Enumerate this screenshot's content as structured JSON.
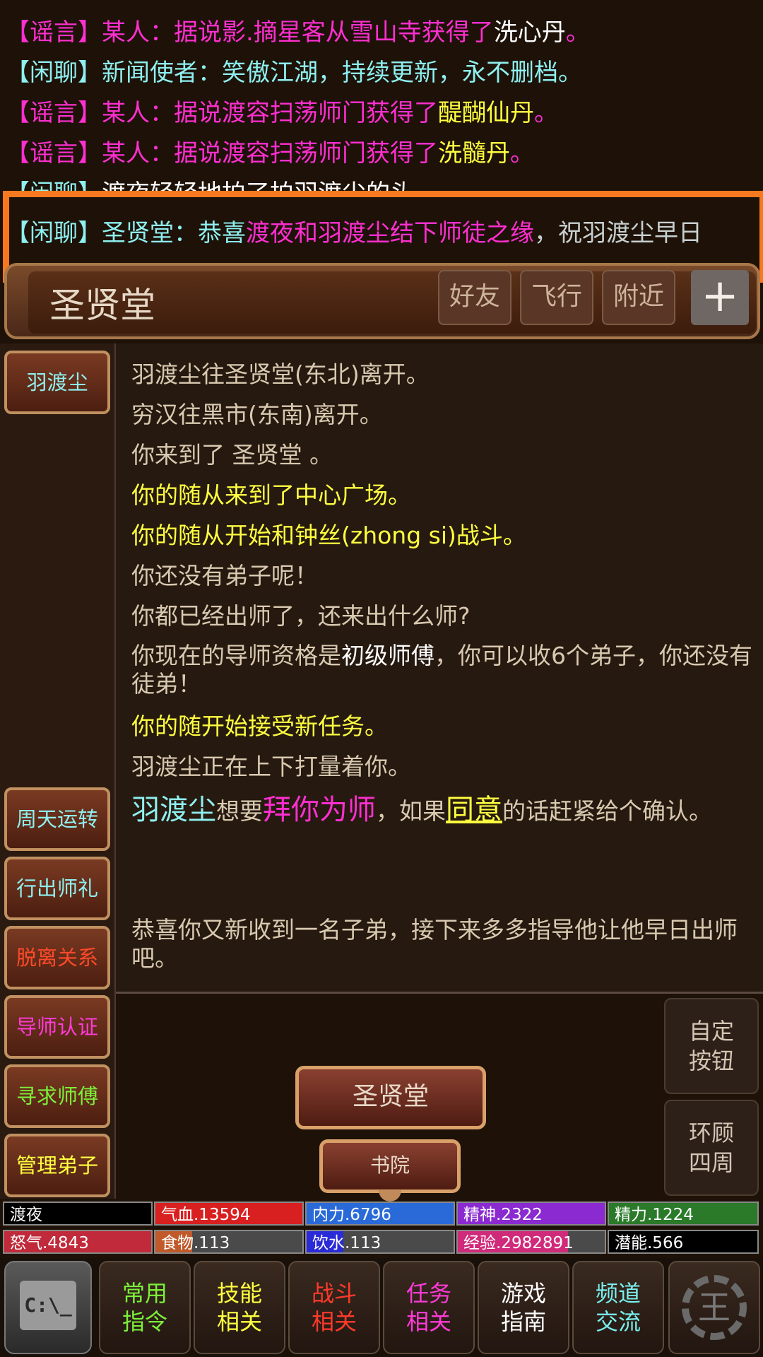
{
  "chat": [
    {
      "tag": "【谣言】",
      "speaker": "某人：",
      "text": "据说影.摘星客从雪山寺获得了",
      "item": "洗心丹",
      "end": "。"
    },
    {
      "tag": "【闲聊】",
      "speaker": "新闻使者：",
      "text": "笑傲江湖，持续更新，永不删档。"
    },
    {
      "tag": "【谣言】",
      "speaker": "某人：",
      "text": "据说渡容扫荡师门获得了",
      "item": "醍醐仙丹",
      "end": "。"
    },
    {
      "tag": "【谣言】",
      "speaker": "某人：",
      "text": "据说渡容扫荡师门获得了",
      "item": "洗髓丹",
      "end": "。"
    },
    {
      "tag": "【闲聊】",
      "text": "渡夜轻轻地拍了拍羽渡尘的头。"
    },
    {
      "tag": "【闲聊】",
      "speaker": "圣贤堂：",
      "text": "恭喜",
      "highlight": "渡夜和羽渡尘结下师徒之缘",
      "end": "，祝羽渡尘早日"
    }
  ],
  "location": {
    "title": "圣贤堂",
    "buttons": [
      "好友",
      "飞行",
      "附近"
    ],
    "plus": "+"
  },
  "sidebar": {
    "top": "羽渡尘",
    "items": [
      "周天运转",
      "行出师礼",
      "脱离关系",
      "导师认证",
      "寻求师傅",
      "管理弟子"
    ]
  },
  "messages": [
    "羽渡尘往圣贤堂(东北)离开。",
    "穷汉往黑市(东南)离开。",
    "你来到了 圣贤堂 。",
    "你的随从来到了中心广场。",
    "你的随从开始和钟丝(zhong si)战斗。",
    "你还没有弟子呢！",
    "你都已经出师了，还来出什么师?",
    "你现在的导师资格是",
    "初级师傅",
    "，你可以收6个弟子，你还没有徒弟！",
    "你的随开始接受新任务。",
    "羽渡尘正在上下打量着你。",
    "羽渡尘",
    "想要",
    "拜你为师",
    "，如果",
    "同意",
    "的话赶紧给个确认。",
    "恭喜你又新收到一名子弟，接下来多多指导他让他早日出师吧。"
  ],
  "actions": {
    "room": "圣贤堂",
    "exit": "书院",
    "custom": "自定按钮",
    "look": "环顾四周"
  },
  "stats": [
    {
      "label": "渡夜",
      "color": "#000000",
      "level": 1.0
    },
    {
      "label": "气血.13594",
      "color": "#d82020",
      "level": 1.0
    },
    {
      "label": "内力.6796",
      "color": "#2a6ad8",
      "level": 1.0
    },
    {
      "label": "精神.2322",
      "color": "#8a2ad0",
      "level": 1.0
    },
    {
      "label": "精力.1224",
      "color": "#2a7a2a",
      "level": 1.0
    },
    {
      "label": "怒气.4843",
      "color": "#c02a3a",
      "level": 1.0
    },
    {
      "label": "食物.113",
      "color": "#c05a2a",
      "level": 0.25
    },
    {
      "label": "饮水.113",
      "color": "#2a2ad8",
      "level": 0.25
    },
    {
      "label": "经验.2982891",
      "color": "#d02a7a",
      "level": 0.75
    },
    {
      "label": "潜能.566",
      "color": "#000000",
      "level": 1.0
    }
  ],
  "toolbar": [
    {
      "l1": "常用",
      "l2": "指令",
      "color": "#7cf03a"
    },
    {
      "l1": "技能",
      "l2": "相关",
      "color": "#ffff40"
    },
    {
      "l1": "战斗",
      "l2": "相关",
      "color": "#ff3a2a"
    },
    {
      "l1": "任务",
      "l2": "相关",
      "color": "#ff3ad8"
    },
    {
      "l1": "游戏",
      "l2": "指南",
      "color": "#ffffff"
    },
    {
      "l1": "频道",
      "l2": "交流",
      "color": "#7af0f0"
    }
  ],
  "terminal_label": "C:\\_",
  "gear_label": "王"
}
